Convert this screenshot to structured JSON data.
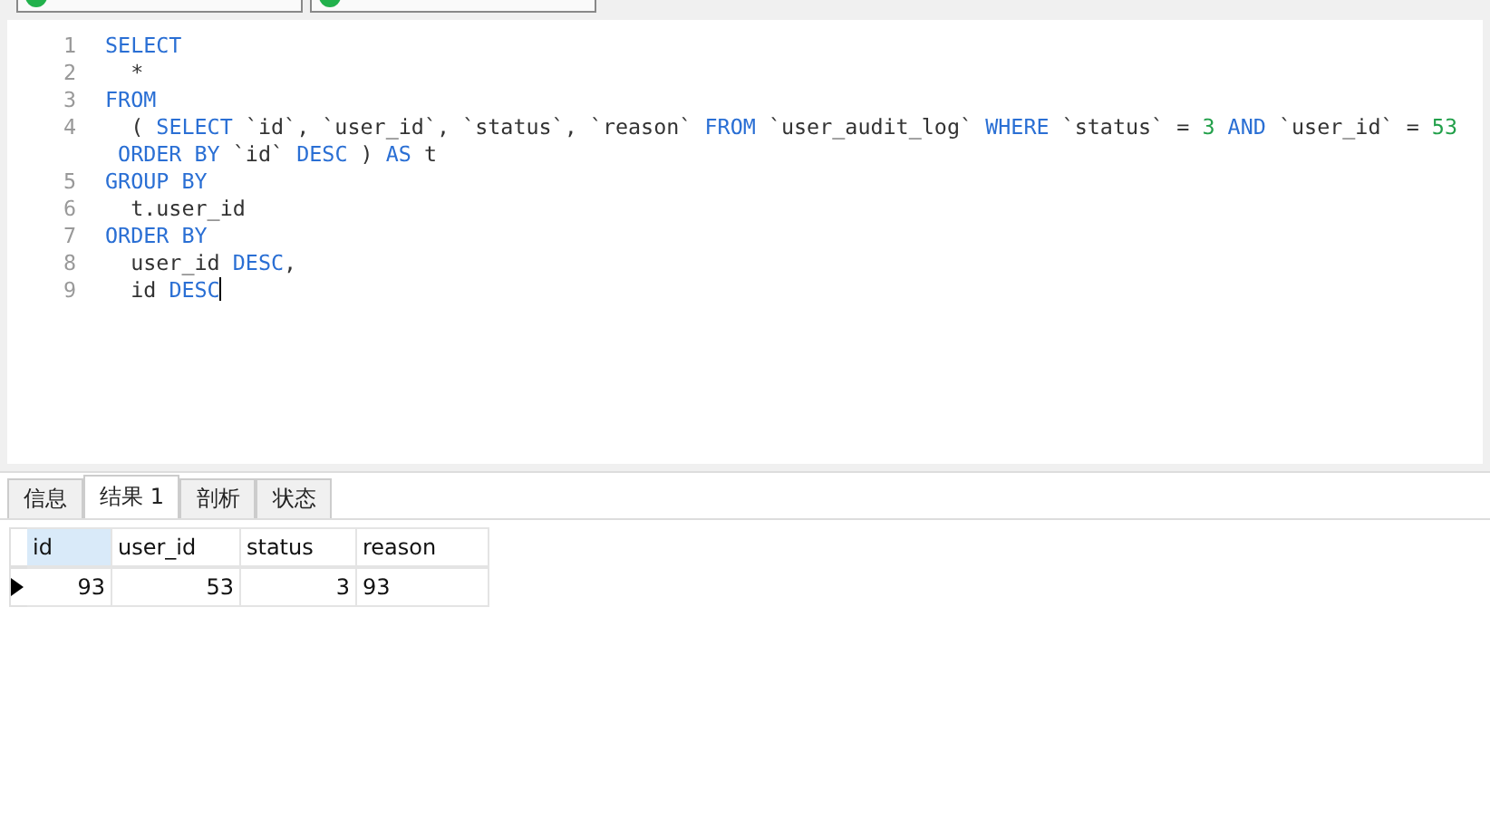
{
  "editor": {
    "lines": [
      {
        "number": "1",
        "tokens": [
          {
            "kind": "keyword",
            "text": "SELECT"
          }
        ]
      },
      {
        "number": "2",
        "tokens": [
          {
            "kind": "plain",
            "text": "  *"
          }
        ]
      },
      {
        "number": "3",
        "tokens": [
          {
            "kind": "keyword",
            "text": "FROM"
          }
        ]
      },
      {
        "number": "4",
        "tokens": [
          {
            "kind": "plain",
            "text": "  ( "
          },
          {
            "kind": "keyword",
            "text": "SELECT"
          },
          {
            "kind": "plain",
            "text": " `id`, `user_id`, `status`, `reason` "
          },
          {
            "kind": "keyword",
            "text": "FROM"
          },
          {
            "kind": "plain",
            "text": " `user_audit_log` "
          },
          {
            "kind": "keyword",
            "text": "WHERE"
          },
          {
            "kind": "plain",
            "text": " `status` = "
          },
          {
            "kind": "number",
            "text": "3"
          },
          {
            "kind": "keyword",
            "text": " AND"
          },
          {
            "kind": "plain",
            "text": " `user_id` = "
          },
          {
            "kind": "number",
            "text": "53"
          }
        ]
      },
      {
        "tokens": [
          {
            "kind": "keyword",
            "text": " ORDER BY"
          },
          {
            "kind": "plain",
            "text": " `id` "
          },
          {
            "kind": "keyword",
            "text": "DESC"
          },
          {
            "kind": "plain",
            "text": " ) "
          },
          {
            "kind": "keyword",
            "text": "AS"
          },
          {
            "kind": "plain",
            "text": " t"
          }
        ]
      },
      {
        "number": "5",
        "tokens": [
          {
            "kind": "keyword",
            "text": "GROUP BY"
          }
        ]
      },
      {
        "number": "6",
        "tokens": [
          {
            "kind": "plain",
            "text": "  t.user_id"
          }
        ]
      },
      {
        "number": "7",
        "tokens": [
          {
            "kind": "keyword",
            "text": "ORDER BY"
          }
        ]
      },
      {
        "number": "8",
        "tokens": [
          {
            "kind": "plain",
            "text": "  user_id "
          },
          {
            "kind": "keyword",
            "text": "DESC"
          },
          {
            "kind": "plain",
            "text": ","
          }
        ]
      },
      {
        "number": "9",
        "tokens": [
          {
            "kind": "plain",
            "text": "  id "
          },
          {
            "kind": "keyword",
            "text": "DESC"
          }
        ],
        "cursor": true
      }
    ]
  },
  "result_tabs": [
    {
      "label": "信息",
      "selected": false
    },
    {
      "label": "结果 1",
      "selected": true
    },
    {
      "label": "剖析",
      "selected": false
    },
    {
      "label": "状态",
      "selected": false
    }
  ],
  "table": {
    "columns": [
      {
        "label": "id",
        "selected": true,
        "kind": "numeric"
      },
      {
        "label": "user_id",
        "selected": false,
        "kind": "numeric"
      },
      {
        "label": "status",
        "selected": false,
        "kind": "numeric"
      },
      {
        "label": "reason",
        "selected": false,
        "kind": "text"
      }
    ],
    "rows": [
      {
        "current": true,
        "cells": [
          "93",
          "53",
          "3",
          "93"
        ]
      }
    ]
  }
}
